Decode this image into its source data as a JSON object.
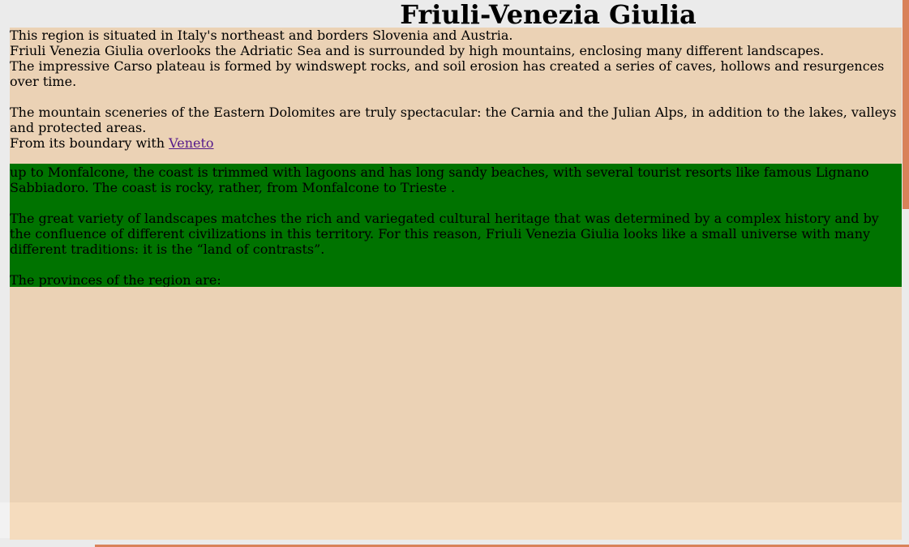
{
  "header": {
    "title": "Friuli-Venezia Giulia"
  },
  "content": {
    "p1": "This region is situated in Italy's northeast and borders Slovenia and Austria.",
    "p2": "Friuli Venezia Giulia overlooks the Adriatic Sea and is surrounded by high mountains, enclosing many different landscapes.",
    "p3": "The impressive Carso plateau is formed by windswept rocks, and soil erosion has created a series of caves, hollows and resurgences over time.",
    "p4": "The mountain sceneries of the Eastern Dolomites are truly spectacular: the Carnia and the Julian Alps, in addition to the lakes, valleys and protected areas.",
    "p5_prefix": "From its boundary with ",
    "p5_link": "Veneto",
    "green": {
      "p1": " up to Monfalcone, the coast is trimmed with lagoons and has long sandy beaches, with several tourist resorts like famous Lignano Sabbiadoro. The coast is rocky, rather, from Monfalcone to Trieste .",
      "p2": "The great variety of landscapes matches the rich and variegated cultural heritage that was determined by a complex history and by the confluence of different civilizations in this territory. For this reason, Friuli Venezia Giulia looks like a small universe with many different traditions: it is the “land of contrasts”.",
      "p3": "The provinces of the region are:"
    }
  },
  "colors": {
    "background": "#ebebeb",
    "content_bg": "#ebd2b5",
    "green_block": "#007300",
    "scrollbar_thumb": "#d9825a",
    "link": "#551a8b"
  },
  "icons": {
    "scrollbar": "scrollbar-thumb"
  }
}
